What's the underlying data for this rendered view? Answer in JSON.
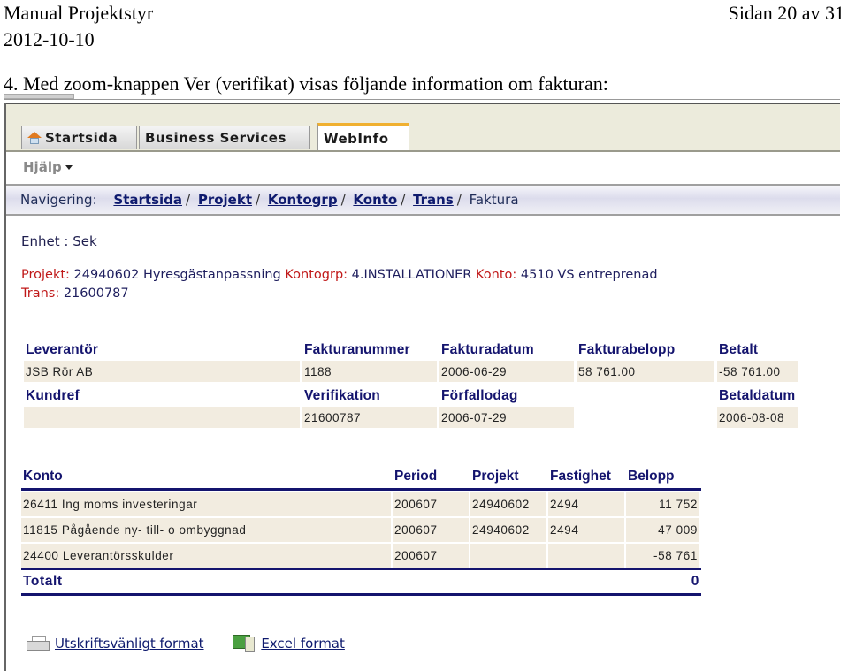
{
  "document": {
    "title": "Manual Projektstyr",
    "date": "2012-10-10",
    "page_label": "Sidan 20 av 31",
    "step_text": "4. Med zoom-knappen Ver (verifikat) visas följande information om fakturan:"
  },
  "app": {
    "tabs": [
      {
        "label": "Startsida",
        "icon": "home-icon",
        "active": false
      },
      {
        "label": "Business Services",
        "active": false
      },
      {
        "label": "WebInfo",
        "active": true
      }
    ],
    "help_menu": "Hjälp",
    "navigation": {
      "label": "Navigering:",
      "crumbs": [
        "Startsida",
        "Projekt",
        "Kontogrp",
        "Konto",
        "Trans"
      ],
      "current": "Faktura"
    },
    "unit": "Enhet : Sek",
    "meta": {
      "projekt_key": "Projekt:",
      "projekt_value": "24940602 Hyresgästanpassning",
      "kontogrp_key": "Kontogrp:",
      "kontogrp_value": "4.INSTALLATIONER",
      "konto_key": "Konto:",
      "konto_value": "4510 VS entreprenad",
      "trans_key": "Trans:",
      "trans_value": "21600787"
    },
    "invoice": {
      "headers1": [
        "Leverantör",
        "Fakturanummer",
        "Fakturadatum",
        "Fakturabelopp",
        "Betalt"
      ],
      "values1": [
        "JSB Rör AB",
        "1188",
        "2006-06-29",
        "58 761.00",
        "-58 761.00"
      ],
      "headers2": [
        "Kundref",
        "Verifikation",
        "Förfallodag",
        "",
        "Betaldatum"
      ],
      "values2": [
        "",
        "21600787",
        "2006-07-29",
        "",
        "2006-08-08"
      ]
    },
    "accounts": {
      "headers": [
        "Konto",
        "Period",
        "Projekt",
        "Fastighet",
        "Belopp"
      ],
      "rows": [
        [
          "26411 Ing moms investeringar",
          "200607",
          "24940602",
          "2494",
          "11 752"
        ],
        [
          "11815 Pågående ny- till- o ombyggnad",
          "200607",
          "24940602",
          "2494",
          "47 009"
        ],
        [
          "24400 Leverantörsskulder",
          "200607",
          "",
          "",
          "-58 761"
        ]
      ],
      "total_label": "Totalt",
      "total_value": "0"
    },
    "links": {
      "print": "Utskriftsvänligt format",
      "excel": "Excel format"
    }
  }
}
